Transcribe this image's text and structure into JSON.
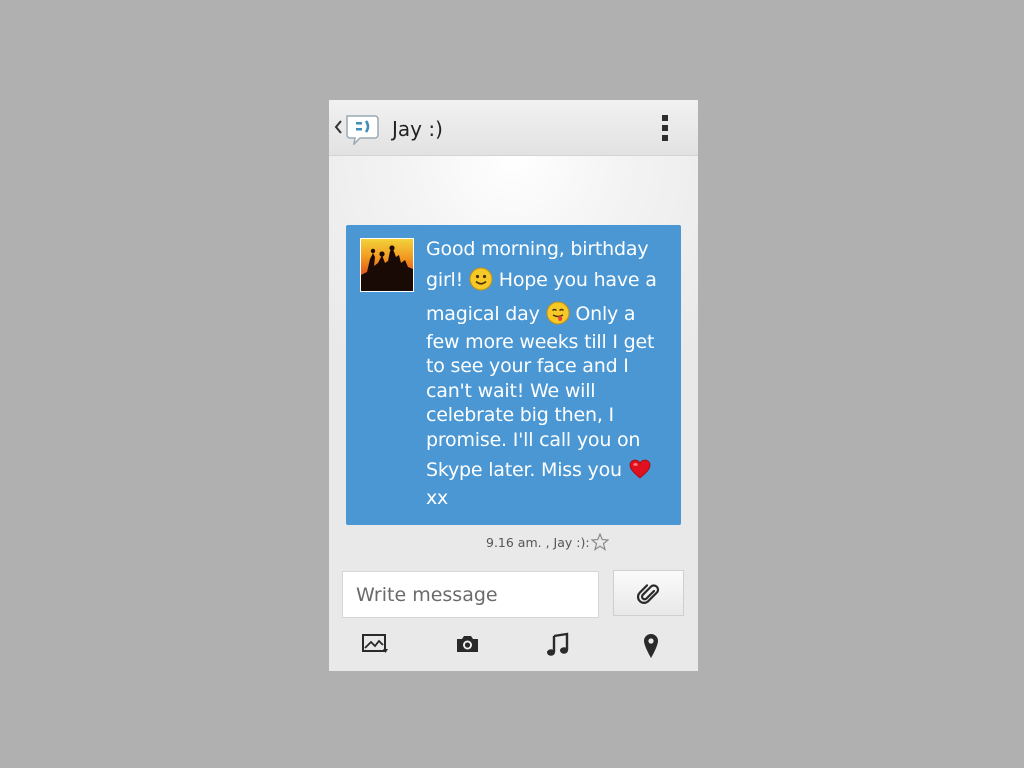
{
  "header": {
    "contact_name": "Jay :)",
    "back_icon": "chevron-left-icon",
    "app_icon": "messaging-app-icon",
    "menu_icon": "overflow-menu-icon"
  },
  "message": {
    "avatar_icon": "contact-photo-silhouettes",
    "lines": [
      "Good morning, birthday",
      "girl!",
      "Hope you have a",
      "magical day",
      "Only a",
      "few more weeks till I get",
      "to see your face and I",
      "can't wait! We will",
      "celebrate big then, I",
      "promise. I'll call you on",
      "Skype later. Miss you",
      "xx"
    ],
    "emojis": [
      "smiling-face-emoji",
      "winking-tongue-emoji",
      "red-heart-emoji"
    ],
    "bubble_color": "#4a97d4",
    "timestamp": "9.16 am. , Jay :):",
    "star_icon": "star-outline-icon"
  },
  "compose": {
    "placeholder": "Write message",
    "attach_icon": "paperclip-icon"
  },
  "toolbar": {
    "items": [
      "gallery-icon",
      "camera-icon",
      "music-note-icon",
      "location-pin-icon"
    ]
  }
}
